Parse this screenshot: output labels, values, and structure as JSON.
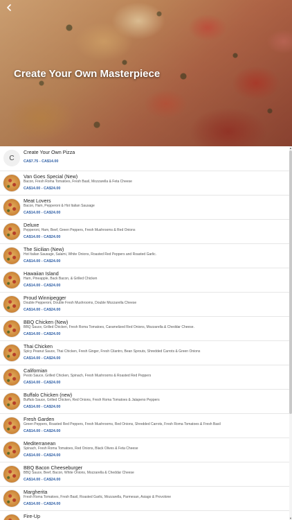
{
  "header": {
    "title": "Create Your Own Masterpiece",
    "back_icon": "chevron-left-icon"
  },
  "colors": {
    "price": "#2f5fa6",
    "name": "#222222",
    "description": "#555555",
    "hero_title": "#ffffff"
  },
  "menu": {
    "items": [
      {
        "letter": "C",
        "name": "Create Your Own Pizza",
        "description": "",
        "price": "CA$7.75 - CA$14.00"
      },
      {
        "name": "Van Goes Special (New)",
        "description": "Bacon, Fresh Roma Tomatoes, Fresh Basil, Mozzarella & Feta Cheese",
        "price": "CA$14.00 - CA$24.00"
      },
      {
        "name": "Meat Lovers",
        "description": "Bacon, Ham, Pepperoni & Hot Italian Sausage",
        "price": "CA$14.00 - CA$24.00"
      },
      {
        "name": "Deluxe",
        "description": "Pepperoni, Ham, Beef, Green Peppers, Fresh Mushrooms & Red Onions",
        "price": "CA$14.00 - CA$24.00"
      },
      {
        "name": "The Sicilian (New)",
        "description": "Hot Italian Sausage, Salami, White Onions, Roasted Red Peppers and Roasted Garlic.",
        "price": "CA$14.00 - CA$24.00"
      },
      {
        "name": "Hawaiian Island",
        "description": "Ham, Pineapple, Back Bacon, & Grilled Chicken",
        "price": "CA$14.00 - CA$24.00"
      },
      {
        "name": "Proud Winnipegger",
        "description": "Double Pepperoni, Double Fresh Mushrooms, Double Mozzarella Cheese",
        "price": "CA$14.00 - CA$24.00"
      },
      {
        "name": "BBQ Chicken (New)",
        "description": "BBQ Sauce, Grilled Chicken, Fresh Roma Tomatoes, Caramelized Red Onions, Mozzarella & Cheddar Cheese.",
        "price": "CA$14.00 - CA$24.00"
      },
      {
        "name": "Thai Chicken",
        "description": "Spicy Peanut Sauce, Thai Chicken, Fresh Ginger, Fresh Cilantro, Bean Sprouts, Shredded Carrots & Green Onions",
        "price": "CA$14.00 - CA$24.00"
      },
      {
        "name": "Californian",
        "description": "Pesto Sauce, Grilled Chicken, Spinach, Fresh Mushrooms & Roasted Red Peppers",
        "price": "CA$14.00 - CA$24.00"
      },
      {
        "name": "Buffalo Chicken (new)",
        "description": "Buffalo Sauce, Grilled Chicken, Red Onions, Fresh Roma Tomatoes & Jalapeno Peppers",
        "price": "CA$14.00 - CA$24.00"
      },
      {
        "name": "Fresh Garden",
        "description": "Green Peppers, Roasted Red Peppers, Fresh Mushrooms, Red Onions, Shredded Carrots, Fresh Roma Tomatoes & Fresh Basil",
        "price": "CA$14.00 - CA$24.00"
      },
      {
        "name": "Mediterranean",
        "description": "Spinach, Fresh Roma Tomatoes, Red Onions, Black Olives & Feta Cheese",
        "price": "CA$14.00 - CA$24.00"
      },
      {
        "name": "BBQ Bacon Cheeseburger",
        "description": "BBQ Sauce, Beef, Bacon, White Onions, Mozzarella & Cheddar Cheese",
        "price": "CA$14.00 - CA$24.00"
      },
      {
        "name": "Margherita",
        "description": "Fresh Roma Tomatoes, Fresh Basil, Roasted Garlic, Mozzarella, Parmesan, Asiago & Provolone",
        "price": "CA$14.00 - CA$24.00"
      },
      {
        "name": "Fire-Up",
        "description": "",
        "price": ""
      }
    ]
  }
}
